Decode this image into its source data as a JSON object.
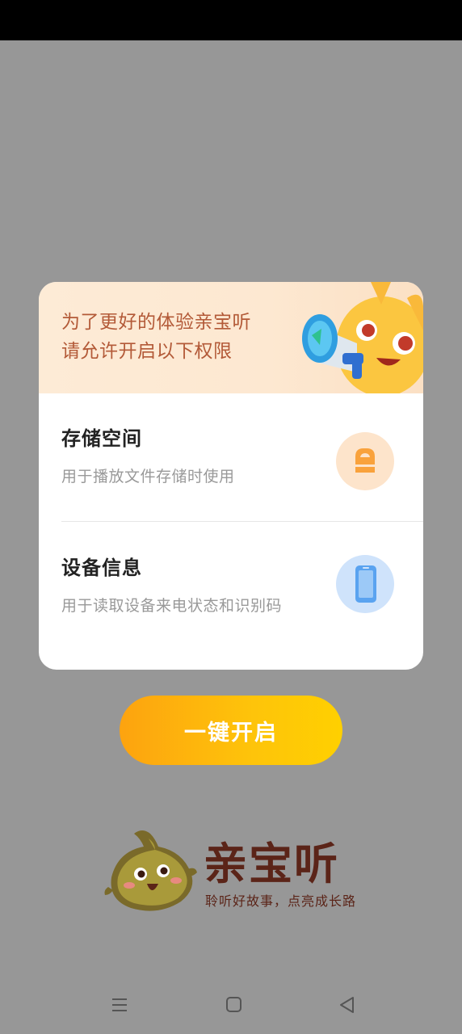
{
  "dialog": {
    "header_line1": "为了更好的体验亲宝听",
    "header_line2": "请允许开启以下权限",
    "permissions": [
      {
        "title": "存储空间",
        "description": "用于播放文件存储时使用",
        "icon": "storage-icon"
      },
      {
        "title": "设备信息",
        "description": "用于读取设备来电状态和识别码",
        "icon": "phone-icon"
      }
    ]
  },
  "enable_button": {
    "label": "一键开启"
  },
  "brand": {
    "name": "亲宝听",
    "slogan": "聆听好故事，点亮成长路"
  },
  "colors": {
    "overlay": "#979797",
    "header_text": "#b35a38",
    "button_gradient_start": "#fda30f",
    "button_gradient_end": "#ffd000",
    "brand_text": "#5b2418"
  },
  "nav": {
    "buttons": [
      "menu-icon",
      "home-icon",
      "back-icon"
    ]
  }
}
